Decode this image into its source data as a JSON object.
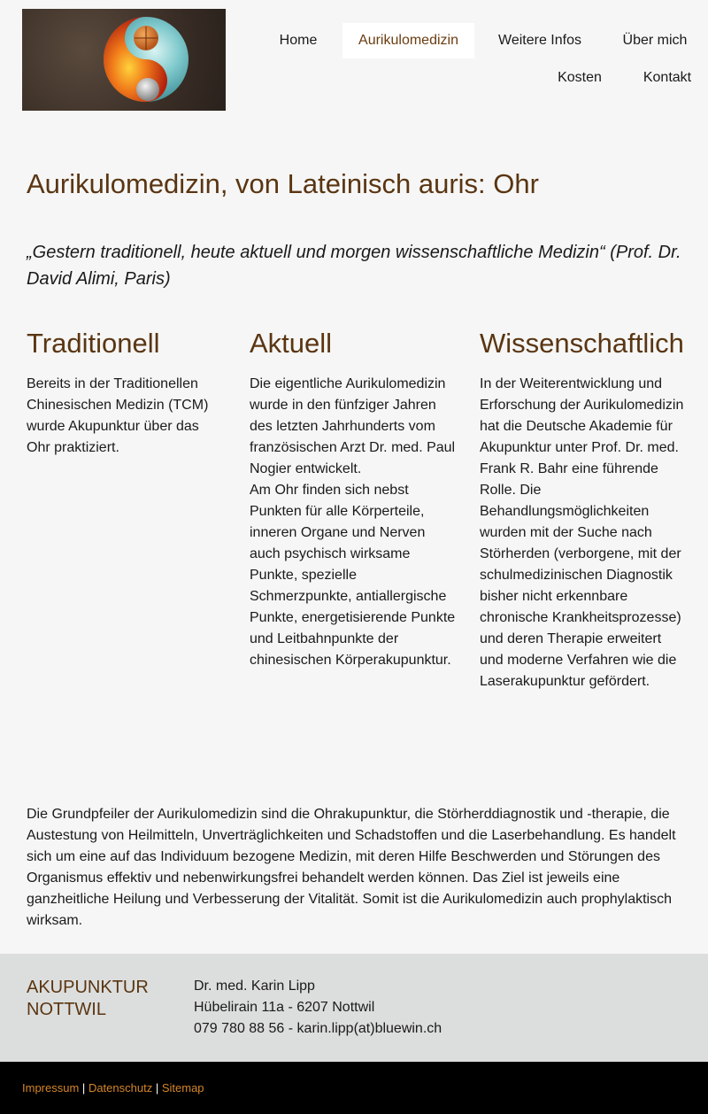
{
  "header": {
    "logo_name": "yin-yang-logo"
  },
  "nav": {
    "items": [
      {
        "label": "Home"
      },
      {
        "label": "Aurikulomedizin"
      },
      {
        "label": "Weitere Infos"
      },
      {
        "label": "Über mich"
      },
      {
        "label": "Kosten"
      },
      {
        "label": "Kontakt"
      }
    ],
    "active_index": 1
  },
  "main": {
    "title": "Aurikulomedizin, von Lateinisch auris: Ohr",
    "quote": "„Gestern traditionell, heute aktuell und morgen wissenschaftliche Medizin“ (Prof. Dr. David Alimi, Paris)",
    "columns": [
      {
        "heading": "Traditionell",
        "text": "Bereits in der Traditionellen Chinesischen Medizin (TCM) wurde Akupunktur über das Ohr praktiziert."
      },
      {
        "heading": "Aktuell",
        "text": "Die eigentliche Aurikulomedizin wurde in den fünfziger Jahren des letzten Jahrhunderts vom französischen Arzt Dr. med. Paul Nogier entwickelt.",
        "text2": "Am Ohr finden sich nebst Punkten für alle Körperteile, inneren Organe und Nerven auch psychisch wirksame Punkte, spezielle Schmerzpunkte, antiallergische Punkte, energetisierende Punkte und Leitbahnpunkte der chinesischen Körperakupunktur."
      },
      {
        "heading": "Wissenschaftlich",
        "text": "In der Weiterentwicklung und Erforschung der Aurikulomedizin hat die Deutsche Akademie für Akupunktur unter Prof. Dr. med. Frank R. Bahr eine führende Rolle. Die Behandlungsmöglichkeiten wurden mit der Suche nach Störherden (verborgene, mit der schulmedizinischen Diagnostik bisher nicht erkennbare chronische Krankheitsprozesse) und deren Therapie erweitert und moderne Verfahren wie die Laserakupunktur gefördert."
      }
    ],
    "paragraph": "Die Grundpfeiler der Aurikulomedizin sind die Ohrakupunktur, die Störherddiagnostik und -therapie, die Austestung von Heilmitteln, Unverträglichkeiten und Schadstoffen und die Laserbehandlung. Es handelt sich um eine auf das Individuum bezogene Medizin, mit deren Hilfe Beschwerden und Störungen des Organismus effektiv und nebenwirkungsfrei behandelt werden können. Das Ziel ist jeweils eine ganzheitliche Heilung und Verbesserung der Vitalität. Somit ist die Aurikulomedizin auch prophylaktisch wirksam."
  },
  "footer": {
    "brand_line1": "AKUPUNKTUR",
    "brand_line2": "NOTTWIL",
    "name": "Dr. med. Karin Lipp",
    "street": "Hübelirain 11a - 6207 Nottwil",
    "contact": "079 780 88 56 - karin.lipp(at)bluewin.ch",
    "links": [
      "Impressum",
      "Datenschutz",
      "Sitemap"
    ],
    "separator": "|"
  },
  "colors": {
    "accent": "#5a3512",
    "link": "#d4852a",
    "background": "#f5f6f5",
    "footer_bg": "#dcdedd"
  }
}
